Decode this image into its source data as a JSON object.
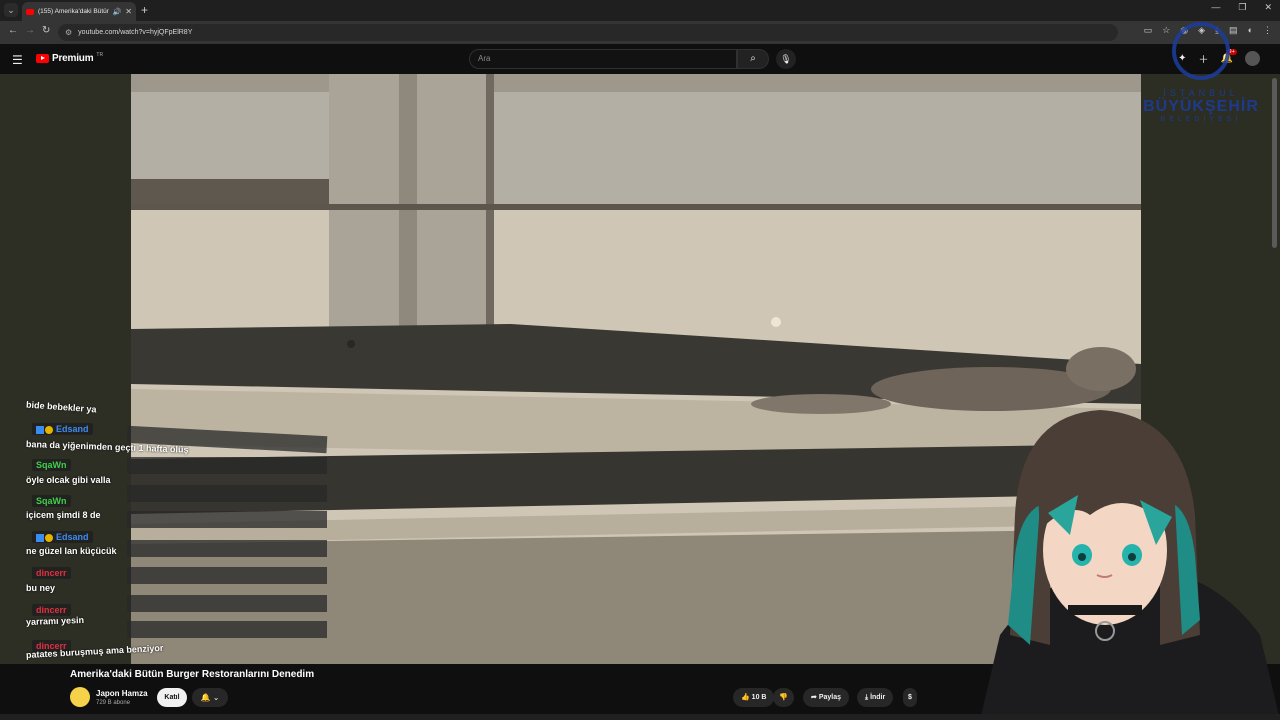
{
  "browser": {
    "tab_title": "(155) Amerika'daki Bütün B",
    "url": "youtube.com/watch?v=hyjQFpElR8Y"
  },
  "youtube": {
    "logo_text": "Premium",
    "logo_region": "TR",
    "search_placeholder": "Ara",
    "notification_count": "9+"
  },
  "watermark": {
    "line1": "İSTANBUL",
    "line2": "BÜYÜKŞEHİR",
    "line3": "BELEDİYESİ"
  },
  "chat": {
    "messages": [
      {
        "text": "bide bebekler ya"
      },
      {
        "user": "Edsand",
        "text": "bana da yiğenimden geçti 1 hafta ölüş"
      },
      {
        "user": "SqaWn",
        "text": "öyle olcak gibi valla"
      },
      {
        "user": "SqaWn",
        "text": "içicem şimdi 8 de"
      },
      {
        "user": "Edsand",
        "text": "ne güzel lan küçücük"
      },
      {
        "user": "dincerr",
        "text": "bu ney"
      },
      {
        "user": "dincerr",
        "text": "yarramı yesin"
      },
      {
        "user": "dincerr",
        "text": "patates buruşmuş ama benziyor"
      }
    ]
  },
  "video": {
    "title": "Amerika'daki Bütün Burger Restoranlarını Denedim",
    "channel": "Japon Hamza",
    "subscribers": "729 B abone",
    "join_label": "Katıl",
    "likes": "10 B",
    "share_label": "Paylaş",
    "download_label": "İndir"
  },
  "colors": {
    "brand_red": "#ff0000",
    "user_blue": "#3b8cf0",
    "user_green": "#3fcf4a",
    "user_red": "#e23040",
    "watermark_blue": "#1b3d9e"
  }
}
